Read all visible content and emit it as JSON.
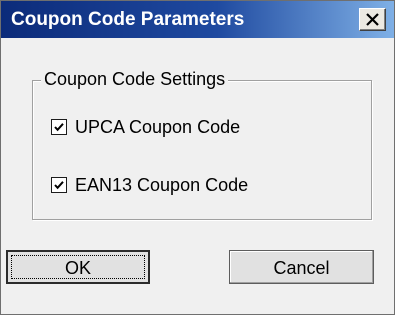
{
  "window": {
    "title": "Coupon Code Parameters",
    "close_icon": "close-icon"
  },
  "settings_group": {
    "title": "Coupon Code Settings",
    "options": [
      {
        "label": "UPCA Coupon Code",
        "checked": true
      },
      {
        "label": "EAN13 Coupon Code",
        "checked": true
      }
    ]
  },
  "buttons": {
    "ok_label": "OK",
    "cancel_label": "Cancel"
  },
  "colors": {
    "titlebar_start": "#0c2b7a",
    "titlebar_end": "#7fb0e6",
    "dialog_bg": "#f0f0f0"
  }
}
